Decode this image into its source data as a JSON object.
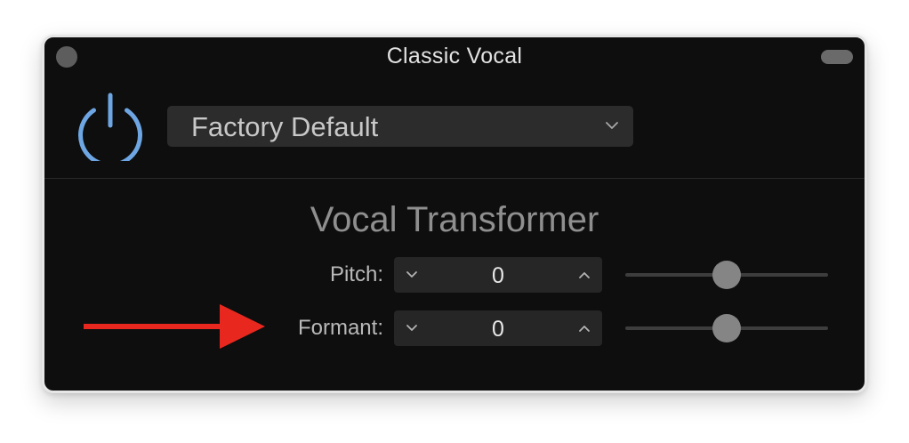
{
  "window": {
    "title": "Classic Vocal"
  },
  "preset": {
    "name": "Factory Default",
    "chevron_icon": "chevron-down-icon"
  },
  "plugin": {
    "name": "Vocal Transformer"
  },
  "params": {
    "pitch": {
      "label": "Pitch:",
      "value": "0",
      "slider_fraction": 0.5
    },
    "formant": {
      "label": "Formant:",
      "value": "0",
      "slider_fraction": 0.5
    }
  },
  "colors": {
    "window_bg": "#0e0e0e",
    "power_accent": "#6ea6e3",
    "annotation_arrow": "#e8281f"
  }
}
